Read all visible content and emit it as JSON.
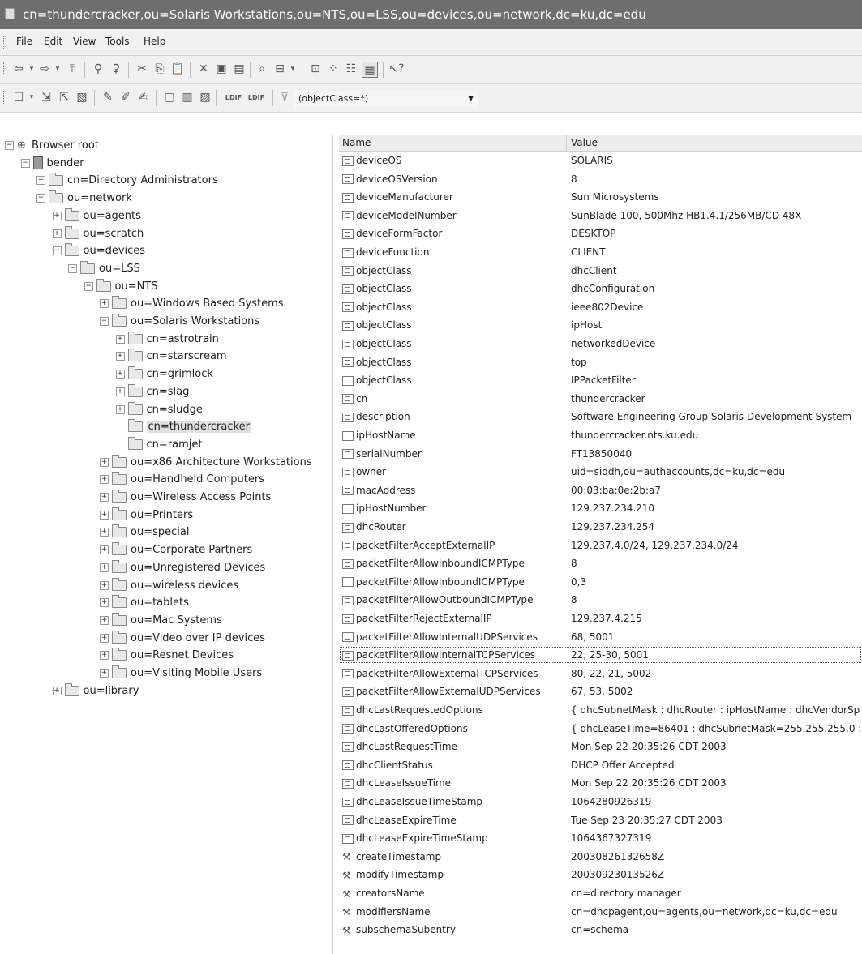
{
  "window": {
    "title": "cn=thundercracker,ou=Solaris Workstations,ou=NTS,ou=LSS,ou=devices,ou=network,dc=ku,dc=edu"
  },
  "menu": [
    "File",
    "Edit",
    "View",
    "Tools",
    "Help"
  ],
  "filter": {
    "value": "(objectClass=*)"
  },
  "tree": [
    {
      "label": "Browser root",
      "level": 0,
      "icon": "root",
      "exp": "minus"
    },
    {
      "label": "bender",
      "level": 1,
      "icon": "server",
      "exp": "minus"
    },
    {
      "label": "cn=Directory Administrators",
      "level": 2,
      "icon": "folder",
      "exp": "plus"
    },
    {
      "label": "ou=network",
      "level": 2,
      "icon": "folder",
      "exp": "minus"
    },
    {
      "label": "ou=agents",
      "level": 3,
      "icon": "folder",
      "exp": "plus"
    },
    {
      "label": "ou=scratch",
      "level": 3,
      "icon": "folder",
      "exp": "plus"
    },
    {
      "label": "ou=devices",
      "level": 3,
      "icon": "folder",
      "exp": "minus"
    },
    {
      "label": "ou=LSS",
      "level": 4,
      "icon": "folder",
      "exp": "minus"
    },
    {
      "label": "ou=NTS",
      "level": 5,
      "icon": "folder",
      "exp": "minus"
    },
    {
      "label": "ou=Windows Based Systems",
      "level": 6,
      "icon": "folder",
      "exp": "plus"
    },
    {
      "label": "ou=Solaris Workstations",
      "level": 6,
      "icon": "folder",
      "exp": "minus"
    },
    {
      "label": "cn=astrotrain",
      "level": 7,
      "icon": "folder",
      "exp": "plus"
    },
    {
      "label": "cn=starscream",
      "level": 7,
      "icon": "folder",
      "exp": "plus"
    },
    {
      "label": "cn=grimlock",
      "level": 7,
      "icon": "folder",
      "exp": "plus"
    },
    {
      "label": "cn=slag",
      "level": 7,
      "icon": "folder",
      "exp": "plus"
    },
    {
      "label": "cn=sludge",
      "level": 7,
      "icon": "folder",
      "exp": "plus"
    },
    {
      "label": "cn=thundercracker",
      "level": 7,
      "icon": "folder-open",
      "exp": "none",
      "selected": true
    },
    {
      "label": "cn=ramjet",
      "level": 7,
      "icon": "folder",
      "exp": "none"
    },
    {
      "label": "ou=x86 Architecture Workstations",
      "level": 6,
      "icon": "folder",
      "exp": "plus"
    },
    {
      "label": "ou=Handheld Computers",
      "level": 6,
      "icon": "folder",
      "exp": "plus"
    },
    {
      "label": "ou=Wireless Access Points",
      "level": 6,
      "icon": "folder",
      "exp": "plus"
    },
    {
      "label": "ou=Printers",
      "level": 6,
      "icon": "folder",
      "exp": "plus"
    },
    {
      "label": "ou=special",
      "level": 6,
      "icon": "folder",
      "exp": "plus"
    },
    {
      "label": "ou=Corporate Partners",
      "level": 6,
      "icon": "folder",
      "exp": "plus"
    },
    {
      "label": "ou=Unregistered Devices",
      "level": 6,
      "icon": "folder",
      "exp": "plus"
    },
    {
      "label": "ou=wireless devices",
      "level": 6,
      "icon": "folder",
      "exp": "plus"
    },
    {
      "label": "ou=tablets",
      "level": 6,
      "icon": "folder",
      "exp": "plus"
    },
    {
      "label": "ou=Mac Systems",
      "level": 6,
      "icon": "folder",
      "exp": "plus"
    },
    {
      "label": "ou=Video over IP devices",
      "level": 6,
      "icon": "folder",
      "exp": "plus"
    },
    {
      "label": "ou=Resnet Devices",
      "level": 6,
      "icon": "folder",
      "exp": "plus"
    },
    {
      "label": "ou=Visiting Mobile Users",
      "level": 6,
      "icon": "folder",
      "exp": "plus"
    },
    {
      "label": "ou=library",
      "level": 3,
      "icon": "folder",
      "exp": "plus"
    }
  ],
  "table": {
    "headers": {
      "name": "Name",
      "value": "Value"
    },
    "rows": [
      {
        "name": "deviceOS",
        "value": "SOLARIS",
        "icon": "attr"
      },
      {
        "name": "deviceOSVersion",
        "value": "8",
        "icon": "attr"
      },
      {
        "name": "deviceManufacturer",
        "value": "Sun Microsystems",
        "icon": "attr"
      },
      {
        "name": "deviceModelNumber",
        "value": "SunBlade 100, 500Mhz HB1.4.1/256MB/CD 48X",
        "icon": "attr"
      },
      {
        "name": "deviceFormFactor",
        "value": "DESKTOP",
        "icon": "attr"
      },
      {
        "name": "deviceFunction",
        "value": "CLIENT",
        "icon": "attr"
      },
      {
        "name": "objectClass",
        "value": "dhcClient",
        "icon": "attr"
      },
      {
        "name": "objectClass",
        "value": "dhcConfiguration",
        "icon": "attr"
      },
      {
        "name": "objectClass",
        "value": "ieee802Device",
        "icon": "attr"
      },
      {
        "name": "objectClass",
        "value": "ipHost",
        "icon": "attr"
      },
      {
        "name": "objectClass",
        "value": "networkedDevice",
        "icon": "attr"
      },
      {
        "name": "objectClass",
        "value": "top",
        "icon": "attr"
      },
      {
        "name": "objectClass",
        "value": "IPPacketFilter",
        "icon": "attr"
      },
      {
        "name": "cn",
        "value": "thundercracker",
        "icon": "attr"
      },
      {
        "name": "description",
        "value": "Software Engineering Group Solaris Development System",
        "icon": "attr"
      },
      {
        "name": "ipHostName",
        "value": "thundercracker.nts.ku.edu",
        "icon": "attr"
      },
      {
        "name": "serialNumber",
        "value": "FT13850040",
        "icon": "attr"
      },
      {
        "name": "owner",
        "value": "uid=siddh,ou=authaccounts,dc=ku,dc=edu",
        "icon": "attr"
      },
      {
        "name": "macAddress",
        "value": "00:03:ba:0e:2b:a7",
        "icon": "attr"
      },
      {
        "name": "ipHostNumber",
        "value": "129.237.234.210",
        "icon": "attr"
      },
      {
        "name": "dhcRouter",
        "value": "129.237.234.254",
        "icon": "attr"
      },
      {
        "name": "packetFilterAcceptExternalIP",
        "value": "129.237.4.0/24, 129.237.234.0/24",
        "icon": "attr"
      },
      {
        "name": "packetFilterAllowInboundICMPType",
        "value": "8",
        "icon": "attr"
      },
      {
        "name": "packetFilterAllowInboundICMPType",
        "value": "0,3",
        "icon": "attr"
      },
      {
        "name": "packetFilterAllowOutboundICMPType",
        "value": "8",
        "icon": "attr"
      },
      {
        "name": "packetFilterRejectExternalIP",
        "value": "129.237.4.215",
        "icon": "attr"
      },
      {
        "name": "packetFilterAllowInternalUDPServices",
        "value": "68, 5001",
        "icon": "attr"
      },
      {
        "name": "packetFilterAllowInternalTCPServices",
        "value": "22, 25-30, 5001",
        "icon": "attr",
        "focused": true
      },
      {
        "name": "packetFilterAllowExternalTCPServices",
        "value": "80, 22, 21, 5002",
        "icon": "attr"
      },
      {
        "name": "packetFilterAllowExternalUDPServices",
        "value": "67, 53, 5002",
        "icon": "attr"
      },
      {
        "name": "dhcLastRequestedOptions",
        "value": "{ dhcSubnetMask : dhcRouter : ipHostName : dhcVendorSp",
        "icon": "attr"
      },
      {
        "name": "dhcLastOfferedOptions",
        "value": "{ dhcLeaseTime=86401 : dhcSubnetMask=255.255.255.0 :",
        "icon": "attr"
      },
      {
        "name": "dhcLastRequestTime",
        "value": "Mon Sep 22 20:35:26 CDT 2003",
        "icon": "attr"
      },
      {
        "name": "dhcClientStatus",
        "value": "DHCP Offer Accepted",
        "icon": "attr"
      },
      {
        "name": "dhcLeaseIssueTime",
        "value": "Mon Sep 22 20:35:26 CDT 2003",
        "icon": "attr"
      },
      {
        "name": "dhcLeaseIssueTimeStamp",
        "value": "1064280926319",
        "icon": "attr"
      },
      {
        "name": "dhcLeaseExpireTime",
        "value": "Tue Sep 23 20:35:27 CDT 2003",
        "icon": "attr"
      },
      {
        "name": "dhcLeaseExpireTimeStamp",
        "value": "1064367327319",
        "icon": "attr"
      },
      {
        "name": "createTimestamp",
        "value": "20030826132658Z",
        "icon": "op"
      },
      {
        "name": "modifyTimestamp",
        "value": "20030923013526Z",
        "icon": "op"
      },
      {
        "name": "creatorsName",
        "value": "cn=directory manager",
        "icon": "op"
      },
      {
        "name": "modifiersName",
        "value": "cn=dhcpagent,ou=agents,ou=network,dc=ku,dc=edu",
        "icon": "op"
      },
      {
        "name": "subschemaSubentry",
        "value": "cn=schema",
        "icon": "op"
      }
    ]
  }
}
